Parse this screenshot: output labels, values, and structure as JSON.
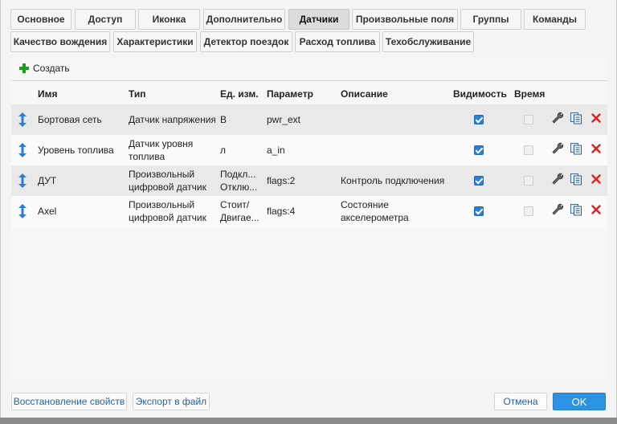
{
  "tabs_row1": [
    {
      "label": "Основное",
      "active": false
    },
    {
      "label": "Доступ",
      "active": false
    },
    {
      "label": "Иконка",
      "active": false
    },
    {
      "label": "Дополнительно",
      "active": false
    },
    {
      "label": "Датчики",
      "active": true
    },
    {
      "label": "Произвольные поля",
      "active": false
    },
    {
      "label": "Группы",
      "active": false
    },
    {
      "label": "Команды",
      "active": false
    }
  ],
  "tabs_row2": [
    {
      "label": "Качество вождения"
    },
    {
      "label": "Характеристики"
    },
    {
      "label": "Детектор поездок"
    },
    {
      "label": "Расход топлива"
    },
    {
      "label": "Техобслуживание"
    }
  ],
  "toolbar": {
    "create_label": "Создать"
  },
  "table": {
    "headers": {
      "name": "Имя",
      "type": "Тип",
      "unit": "Ед. изм.",
      "param": "Параметр",
      "desc": "Описание",
      "visibility": "Видимость",
      "time": "Время"
    },
    "rows": [
      {
        "name": "Бортовая сеть",
        "type1": "Датчик напряжения",
        "type2": "",
        "unit1": "В",
        "unit2": "",
        "param": "pwr_ext",
        "desc1": "",
        "desc2": "",
        "visible": true,
        "time": false
      },
      {
        "name": "Уровень топлива",
        "type1": "Датчик уровня",
        "type2": "топлива",
        "unit1": "л",
        "unit2": "",
        "param": "a_in",
        "desc1": "",
        "desc2": "",
        "visible": true,
        "time": false
      },
      {
        "name": "ДУТ",
        "type1": "Произвольный",
        "type2": "цифровой датчик",
        "unit1": "Подкл...",
        "unit2": "Отклю...",
        "param": "flags:2",
        "desc1": "Контроль подключения",
        "desc2": "",
        "visible": true,
        "time": false
      },
      {
        "name": "Axel",
        "type1": "Произвольный",
        "type2": "цифровой датчик",
        "unit1": "Стоит/",
        "unit2": "Двигае...",
        "param": "flags:4",
        "desc1": "Состояние",
        "desc2": "акселерометра",
        "visible": true,
        "time": false
      }
    ]
  },
  "footer": {
    "restore_label": "Восстановление свойств",
    "export_label": "Экспорт в файл",
    "cancel_label": "Отмена",
    "ok_label": "OK"
  },
  "colors": {
    "accent": "#2b93e3",
    "create_plus": "#19a019",
    "delete": "#e02020",
    "checkbox_on": "#2d7ed6"
  },
  "icons": {
    "row_move": "vertical-arrows-icon",
    "edit": "wrench-icon",
    "copy": "copy-icon",
    "delete": "close-icon"
  }
}
